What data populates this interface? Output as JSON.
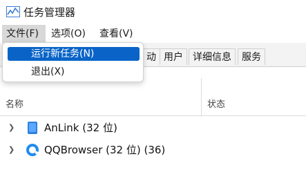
{
  "window": {
    "title": "任务管理器"
  },
  "menubar": {
    "items": [
      "文件(F)",
      "选项(O)",
      "查看(V)"
    ]
  },
  "file_menu": {
    "items": [
      "运行新任务(N)",
      "退出(X)"
    ]
  },
  "tabs": [
    "动",
    "用户",
    "详细信息",
    "服务"
  ],
  "table": {
    "columns": [
      "名称",
      "状态"
    ],
    "rows": [
      {
        "name": "AnLink (32 位)",
        "icon": "anlink-icon"
      },
      {
        "name": "QQBrowser (32 位) (36)",
        "icon": "qqbrowser-icon"
      }
    ]
  },
  "colors": {
    "highlight": "#0a64c8",
    "menu_open": "#d8d8d8",
    "tab_bg": "#f3f3f3"
  }
}
